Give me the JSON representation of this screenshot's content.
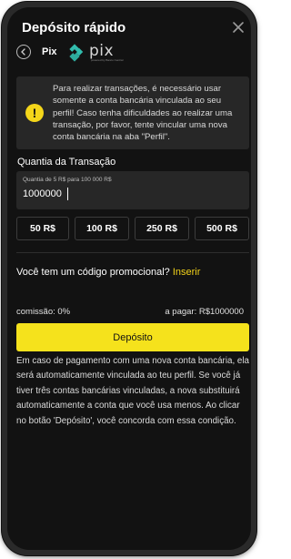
{
  "header": {
    "title": "Depósito rápido",
    "close_icon": "close-icon"
  },
  "method": {
    "back_icon": "chevron-left-icon",
    "label": "Pix",
    "logo_text": "pix",
    "logo_subtext": "powered by Banco Central"
  },
  "alert": {
    "icon_symbol": "!",
    "text": "Para realizar transações, é necessário usar somente a conta bancária vinculada ao seu perfil! Caso tenha dificuldades ao realizar uma transação, por favor, tente vincular uma nova conta bancária na aba \"Perfil\"."
  },
  "amount": {
    "label": "Quantia da Transação",
    "hint": "Quantia de 5 R$ para 100 000 R$",
    "value": "1000000"
  },
  "quick_amounts": [
    "50 R$",
    "100 R$",
    "250 R$",
    "500 R$"
  ],
  "promo": {
    "question": "Você tem um código promocional?",
    "link": "Inserir"
  },
  "summary": {
    "commission": "comissão: 0%",
    "payable": "a pagar: R$1000000"
  },
  "deposit_button": "Depósito",
  "notice": "Em caso de pagamento com uma nova conta bancária, ela será automaticamente vinculada ao teu perfil. Se você já tiver três contas bancárias vinculadas, a nova substituirá automaticamente a conta que você usa menos. Ao clicar no botão 'Depósito', você concorda com essa condição.",
  "colors": {
    "background": "#121212",
    "panel": "#272727",
    "accent": "#f5e21c",
    "pix_teal": "#32bcad"
  }
}
